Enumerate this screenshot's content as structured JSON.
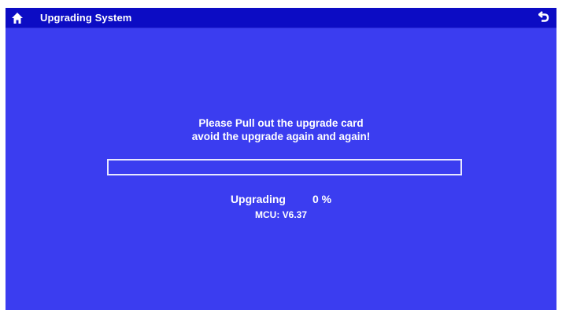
{
  "header": {
    "title": "Upgrading System",
    "home_icon": "home-icon",
    "back_icon": "back-arrow-icon"
  },
  "message": {
    "line1": "Please Pull out the upgrade card",
    "line2": "avoid the upgrade again and again!"
  },
  "progress": {
    "fraction": 0.0,
    "label": "Upgrading",
    "percent_text": "0 %"
  },
  "version": {
    "text": "MCU: V6.37"
  },
  "colors": {
    "background": "#3b3df0",
    "titlebar": "#0c0cc4",
    "text": "#ffffff"
  }
}
